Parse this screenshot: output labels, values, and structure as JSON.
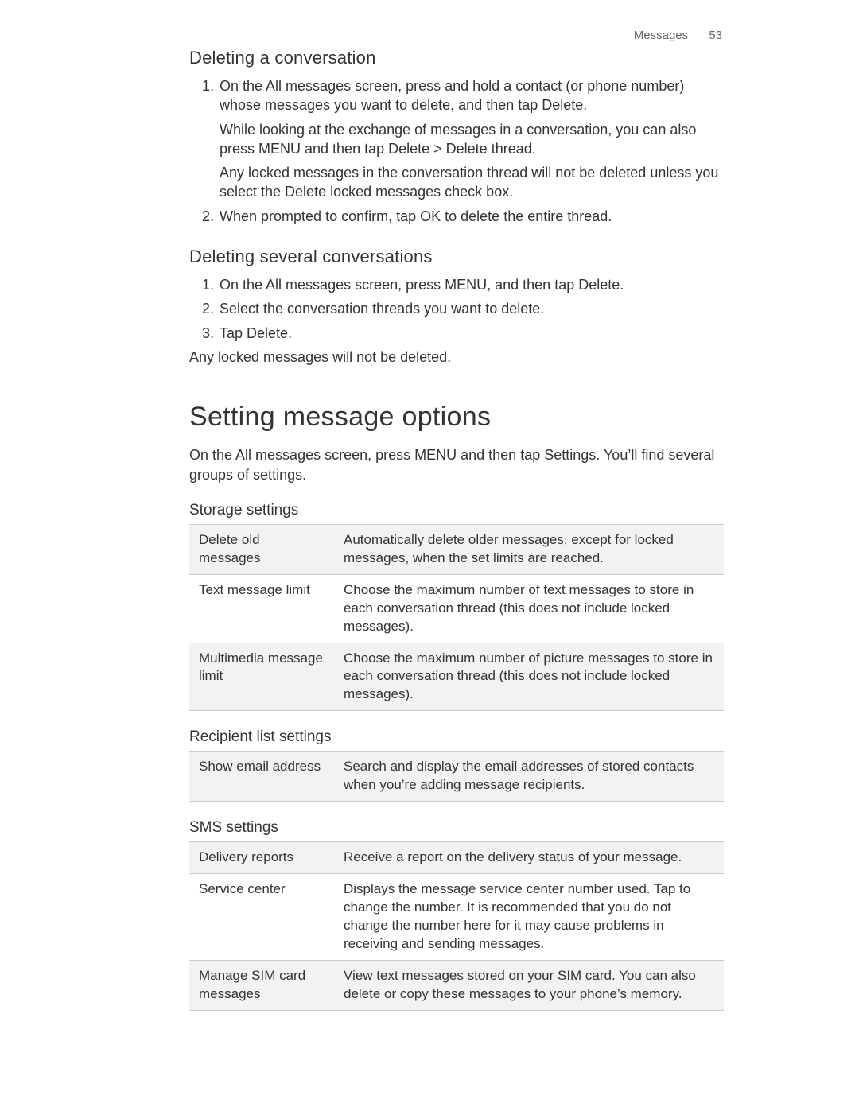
{
  "header": {
    "section": "Messages",
    "page": "53"
  },
  "section1": {
    "heading": "Deleting a conversation",
    "steps": [
      {
        "main_a": "On the All messages screen, press and hold a contact (or phone number) whose messages you want to delete, and then tap ",
        "bold1": "Delete",
        "main_b": ".",
        "p2_a": "While looking at the exchange of messages in a conversation, you can also press MENU and then tap ",
        "p2_bold1": "Delete",
        "p2_b": " > ",
        "p2_bold2": "Delete thread",
        "p2_c": ".",
        "p3_a": "Any locked messages in the conversation thread will not be deleted unless you select the ",
        "p3_bold1": "Delete locked messages",
        "p3_b": " check box."
      },
      {
        "main_a": "When prompted to confirm, tap ",
        "bold1": "OK",
        "main_b": " to delete the entire thread."
      }
    ]
  },
  "section2": {
    "heading": "Deleting several conversations",
    "steps": [
      {
        "main_a": "On the All messages screen, press MENU, and then tap ",
        "bold1": "Delete",
        "main_b": "."
      },
      {
        "main_a": "Select the conversation threads you want to delete."
      },
      {
        "main_a": "Tap ",
        "bold1": "Delete",
        "main_b": "."
      }
    ],
    "note": "Any locked messages will not be deleted."
  },
  "section3": {
    "heading": "Setting message options",
    "intro_a": "On the All messages screen, press MENU and then tap ",
    "intro_bold": "Settings",
    "intro_b": ". You’ll find several groups of settings."
  },
  "storageSettings": {
    "heading": "Storage settings",
    "rows": [
      {
        "label": "Delete old messages",
        "desc": "Automatically delete older messages, except for locked messages, when the set limits are reached."
      },
      {
        "label": "Text message limit",
        "desc": "Choose the maximum number of text messages to store in each conversation thread (this does not include locked messages)."
      },
      {
        "label": "Multimedia message limit",
        "desc": "Choose the maximum number of picture messages to store in each conversation thread (this does not include locked messages)."
      }
    ]
  },
  "recipientSettings": {
    "heading": "Recipient list settings",
    "rows": [
      {
        "label": "Show email address",
        "desc": "Search and display the email addresses of stored contacts when you’re adding message recipients."
      }
    ]
  },
  "smsSettings": {
    "heading": "SMS settings",
    "rows": [
      {
        "label": "Delivery reports",
        "desc": "Receive a report on the delivery status of your message."
      },
      {
        "label": "Service center",
        "desc": "Displays the message service center number used. Tap to change the number. It is recommended that you do not change the number here for it may cause problems in receiving and sending messages."
      },
      {
        "label": "Manage SIM card messages",
        "desc": "View text messages stored on your SIM card. You can also delete or copy these messages to your phone’s memory."
      }
    ]
  }
}
